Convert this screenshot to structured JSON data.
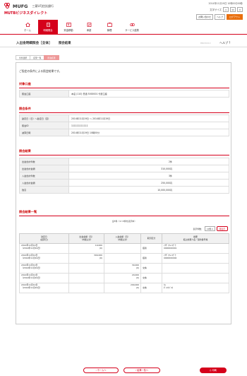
{
  "header": {
    "bank": "MUFG",
    "bank_sub": "三菱UFJ信託銀行",
    "brand": "MUTBビジネスダイレクト",
    "datetime": "2014年11月19日 10時00分00秒",
    "font_size_label": "文字サイズ",
    "font_size_values": [
      "小",
      "中",
      "大"
    ],
    "buttons": [
      "お問い合わせ",
      "ヘルプ"
    ],
    "logout": "ログアウト"
  },
  "nav": [
    "ホーム",
    "明細照会",
    "資金移動",
    "承認",
    "管理",
    "サービス連携"
  ],
  "page": {
    "title": "入出金明細照会［全体］",
    "subtitle": "照会結果",
    "code": "BNM0010",
    "help": "ヘルプ"
  },
  "breadcrumb": [
    "条件選択",
    "結果一覧",
    "照会結果"
  ],
  "intro": "ご指定の条件による照会結果です。",
  "sections": {
    "account": "対象口座",
    "conditions": "照会条件",
    "result": "照会結果",
    "list": "照会結果一覧"
  },
  "account": {
    "label": "照会口座",
    "value": "本店 (110) 普通 5000001 代表口座"
  },
  "conditions": [
    {
      "label": "勘定日（日）～勘定日（至）",
      "value": "2014年11月19日 ～ 2014年11月19日"
    },
    {
      "label": "照会ID",
      "value": "111111111111"
    },
    {
      "label": "減算日時",
      "value": "2014年11月19日 10時00分"
    }
  ],
  "result": [
    {
      "label": "出金合計件数",
      "value": "2件"
    },
    {
      "label": "出金合計金額",
      "value": "310,000円"
    },
    {
      "label": "入金合計件数",
      "value": "3件"
    },
    {
      "label": "入金合計金額",
      "value": "250,000円"
    },
    {
      "label": "残高",
      "value": "10,000,000円"
    }
  ],
  "list_info": "全5件（1～5件を表示中）",
  "display_count_label": "表示件数：",
  "display_count": "10件",
  "sort_button": "再表示",
  "list_headers": [
    "勘定日\n(起算日)",
    "出金金額（円）\n（内税込済）",
    "入金金額（円）\n（内税込済）",
    "取引区分",
    "摘要\n振込依頼人名／契約番号等"
  ],
  "rows": [
    {
      "date": "2014年11月19日",
      "sub": "（2014年11月19日）",
      "out": "10,000",
      "out_sub": "(0)",
      "in": "",
      "in_sub": "",
      "kind": "振替",
      "memo": "ｲｸｻﾞｲﾜﾚﾝｺｳﾞｳ",
      "memo2": "0000000001"
    },
    {
      "date": "2014年11月19日",
      "sub": "（2014年11月19日）",
      "out": "300,000",
      "out_sub": "(0)",
      "in": "",
      "in_sub": "",
      "kind": "振替",
      "memo": "ｲｸｻﾞｲﾜﾚﾝｺｳﾞｳ",
      "memo2": "0000000002"
    },
    {
      "date": "2014年11月19日",
      "sub": "（2014年11月19日）",
      "out": "",
      "out_sub": "",
      "in": "30,000",
      "in_sub": "(0)",
      "kind": "交換",
      "memo": "",
      "memo2": ""
    },
    {
      "date": "2014年11月19日",
      "sub": "（2014年11月19日）",
      "out": "",
      "out_sub": "",
      "in": "20,000",
      "in_sub": "(0)",
      "kind": "交換",
      "memo": "",
      "memo2": ""
    },
    {
      "date": "2014年11月19日",
      "sub": "（2014年11月19日）",
      "out": "",
      "out_sub": "",
      "in": "200,000",
      "in_sub": "(0)",
      "kind": "交換",
      "memo": "ｶﾄ",
      "memo2": "ﾀﾞｲﾜｳｺﾞｺｳ"
    }
  ],
  "footer": {
    "home": "ホームへ",
    "back": "結果一覧へ",
    "print": "印刷"
  }
}
